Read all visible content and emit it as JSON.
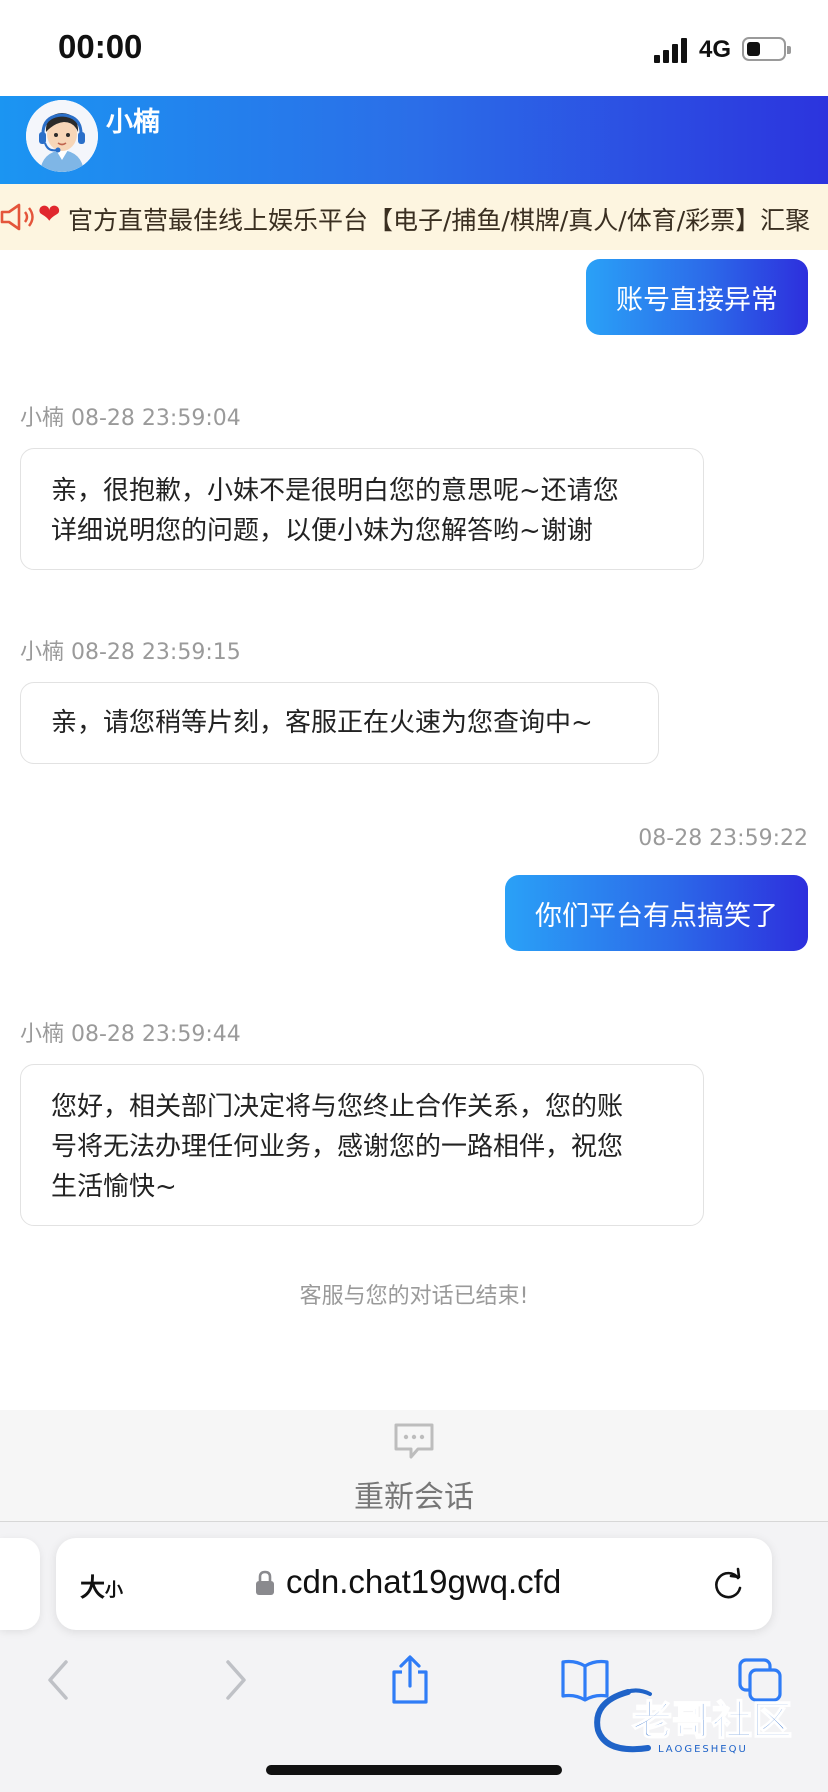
{
  "status_bar": {
    "time": "00:00",
    "network": "4G",
    "battery_level": 0.35
  },
  "header": {
    "agent_name": "小楠"
  },
  "announcement": {
    "text": "官方直营最佳线上娱乐平台【电子/捕鱼/棋牌/真人/体育/彩票】汇聚"
  },
  "messages": [
    {
      "side": "right",
      "meta": "",
      "text": "账号直接异常"
    },
    {
      "side": "left",
      "meta": "小楠 08-28 23:59:04",
      "lines": [
        "亲，很抱歉，小妹不是很明白您的意思呢~还请您",
        "详细说明您的问题，以便小妹为您解答哟~谢谢"
      ]
    },
    {
      "side": "left",
      "meta": "小楠 08-28 23:59:15",
      "lines": [
        "亲，请您稍等片刻，客服正在火速为您查询中~"
      ]
    },
    {
      "side": "right",
      "meta": "08-28 23:59:22",
      "text": "你们平台有点搞笑了"
    },
    {
      "side": "left",
      "meta": "小楠 08-28 23:59:44",
      "lines": [
        "您好，相关部门决定将与您终止合作关系，您的账",
        "号将无法办理任何业务，感谢您的一路相伴，祝您",
        "生活愉快~"
      ]
    }
  ],
  "end_note": "客服与您的对话已结束!",
  "restart": {
    "label": "重新会话"
  },
  "browser": {
    "text_size_label_big": "大",
    "text_size_label_small": "小",
    "url": "cdn.chat19gwq.cfd"
  },
  "watermark": {
    "text": "老哥社区",
    "subtext": "LAOGESHEQU"
  },
  "colors": {
    "accent_start": "#2aa1f7",
    "accent_end": "#2d2fdd",
    "marquee_bg": "#fdf5e0"
  },
  "icons": [
    "signal-icon",
    "battery-icon",
    "speaker-icon",
    "heart-icon",
    "chat-icon",
    "lock-icon",
    "reload-icon",
    "back-icon",
    "forward-icon",
    "share-icon",
    "bookmarks-icon",
    "tabs-icon"
  ]
}
